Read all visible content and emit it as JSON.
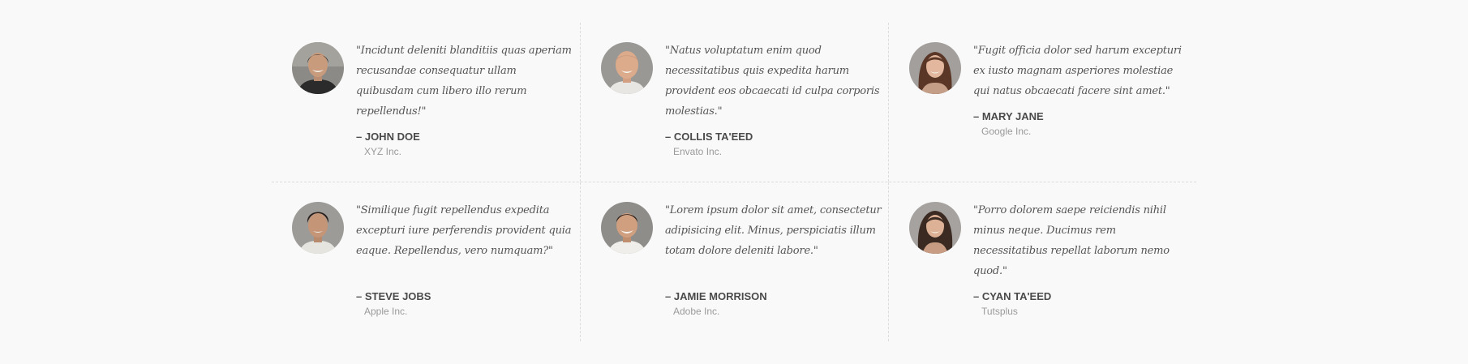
{
  "testimonials": [
    {
      "quote": "\"Incidunt deleniti blanditiis quas aperiam recusandae consequatur ullam quibusdam cum libero illo rerum repellendus!\"",
      "author": "– JOHN DOE",
      "company": "XYZ Inc.",
      "avatar_icon": "person-photo-avatar"
    },
    {
      "quote": "\"Natus voluptatum enim quod necessitatibus quis expedita harum provident eos obcaecati id culpa corporis molestias.\"",
      "author": "– COLLIS TA'EED",
      "company": "Envato Inc.",
      "avatar_icon": "person-photo-avatar"
    },
    {
      "quote": "\"Fugit officia dolor sed harum excepturi ex iusto magnam asperiores molestiae qui natus obcaecati facere sint amet.\"",
      "author": "– MARY JANE",
      "company": "Google Inc.",
      "avatar_icon": "person-photo-avatar"
    },
    {
      "quote": "\"Similique fugit repellendus expedita excepturi iure perferendis provident quia eaque. Repellendus, vero numquam?\"",
      "author": "– STEVE JOBS",
      "company": "Apple Inc.",
      "avatar_icon": "person-photo-avatar"
    },
    {
      "quote": "\"Lorem ipsum dolor sit amet, consectetur adipisicing elit. Minus, perspiciatis illum totam dolore deleniti labore.\"",
      "author": "– JAMIE MORRISON",
      "company": "Adobe Inc.",
      "avatar_icon": "person-photo-avatar"
    },
    {
      "quote": "\"Porro dolorem saepe reiciendis nihil minus neque. Ducimus rem necessitatibus repellat laborum nemo quod.\"",
      "author": "– CYAN TA'EED",
      "company": "Tutsplus",
      "avatar_icon": "person-photo-avatar"
    }
  ],
  "colors": {
    "background": "#f9f9f9",
    "quote_text": "#555555",
    "author_text": "#4a4a4a",
    "company_text": "#9a9a9a",
    "divider": "#dcdcdc"
  }
}
